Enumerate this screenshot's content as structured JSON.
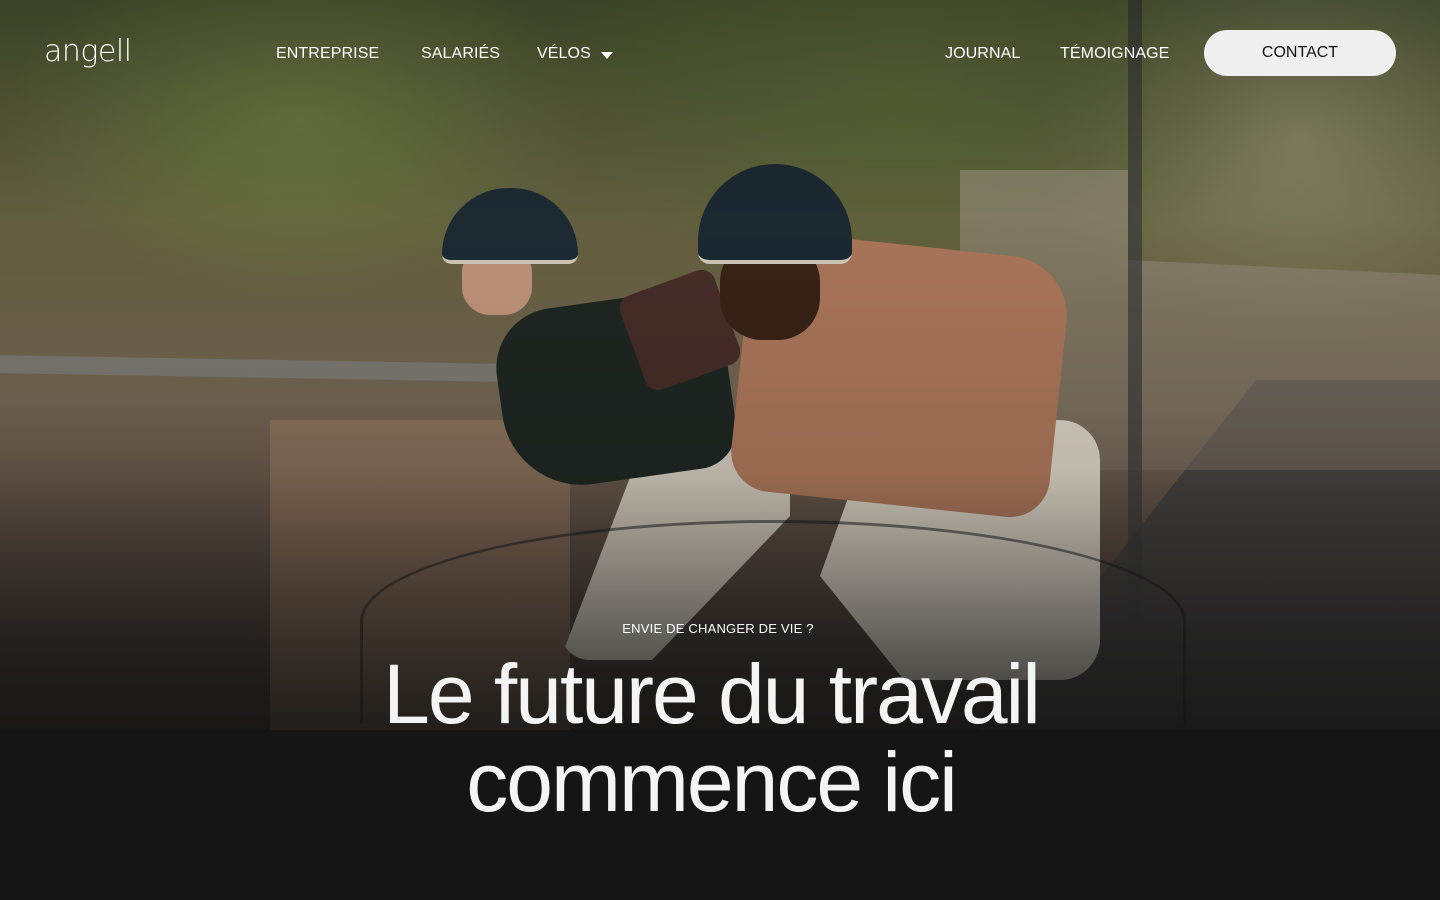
{
  "brand": {
    "logo_text": "angell"
  },
  "nav": {
    "items": [
      {
        "label": "ENTREPRISE"
      },
      {
        "label": "SALARIÉS"
      },
      {
        "label": "VÉLOS",
        "has_dropdown": true
      },
      {
        "label": "JOURNAL"
      },
      {
        "label": "TÉMOIGNAGE"
      }
    ],
    "contact_label": "CONTACT"
  },
  "hero": {
    "eyebrow": "ENVIE DE CHANGER DE VIE ?",
    "headline_line1": "Le future du travail",
    "headline_line2": "commence ici"
  },
  "colors": {
    "background_dark": "#151515",
    "contact_button_bg": "#efefef",
    "text_light": "#f4f4f4"
  }
}
